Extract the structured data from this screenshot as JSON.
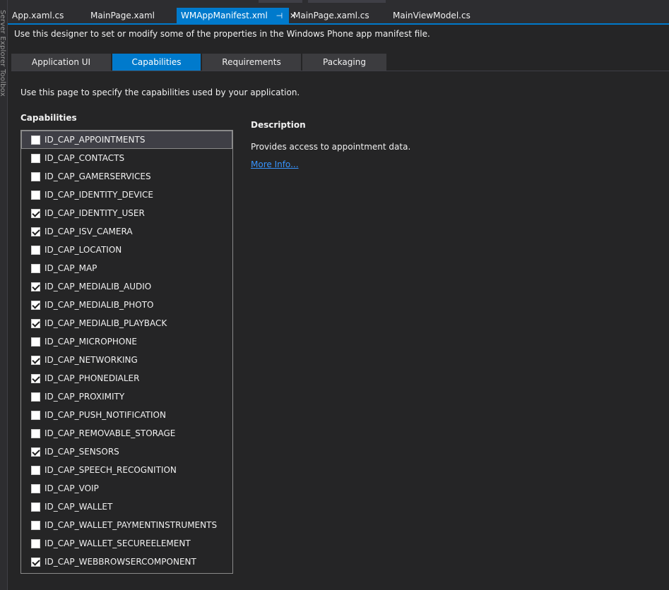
{
  "left_strip": {
    "text": "Server Explorer   Toolbox"
  },
  "doc_tabs": [
    {
      "label": "App.xaml.cs",
      "active": false
    },
    {
      "label": "MainPage.xaml",
      "active": false
    },
    {
      "label": "WMAppManifest.xml",
      "active": true,
      "pin_icon": "⊣",
      "close_icon": "✕"
    },
    {
      "label": "MainPage.xaml.cs",
      "active": false
    },
    {
      "label": "MainViewModel.cs",
      "active": false
    }
  ],
  "intro": "Use this designer to set or modify some of the properties in the Windows Phone app manifest file.",
  "sub_tabs": [
    {
      "label": "Application UI",
      "active": false
    },
    {
      "label": "Capabilities",
      "active": true
    },
    {
      "label": "Requirements",
      "active": false
    },
    {
      "label": "Packaging",
      "active": false
    }
  ],
  "page_desc": "Use this page to specify the capabilities used by your application.",
  "capabilities_heading": "Capabilities",
  "capabilities": [
    {
      "label": "ID_CAP_APPOINTMENTS",
      "checked": false,
      "selected": true
    },
    {
      "label": "ID_CAP_CONTACTS",
      "checked": false
    },
    {
      "label": "ID_CAP_GAMERSERVICES",
      "checked": false
    },
    {
      "label": "ID_CAP_IDENTITY_DEVICE",
      "checked": false
    },
    {
      "label": "ID_CAP_IDENTITY_USER",
      "checked": true
    },
    {
      "label": "ID_CAP_ISV_CAMERA",
      "checked": true
    },
    {
      "label": "ID_CAP_LOCATION",
      "checked": false
    },
    {
      "label": "ID_CAP_MAP",
      "checked": false
    },
    {
      "label": "ID_CAP_MEDIALIB_AUDIO",
      "checked": true
    },
    {
      "label": "ID_CAP_MEDIALIB_PHOTO",
      "checked": true
    },
    {
      "label": "ID_CAP_MEDIALIB_PLAYBACK",
      "checked": true
    },
    {
      "label": "ID_CAP_MICROPHONE",
      "checked": false
    },
    {
      "label": "ID_CAP_NETWORKING",
      "checked": true
    },
    {
      "label": "ID_CAP_PHONEDIALER",
      "checked": true
    },
    {
      "label": "ID_CAP_PROXIMITY",
      "checked": false
    },
    {
      "label": "ID_CAP_PUSH_NOTIFICATION",
      "checked": false
    },
    {
      "label": "ID_CAP_REMOVABLE_STORAGE",
      "checked": false
    },
    {
      "label": "ID_CAP_SENSORS",
      "checked": true
    },
    {
      "label": "ID_CAP_SPEECH_RECOGNITION",
      "checked": false
    },
    {
      "label": "ID_CAP_VOIP",
      "checked": false
    },
    {
      "label": "ID_CAP_WALLET",
      "checked": false
    },
    {
      "label": "ID_CAP_WALLET_PAYMENTINSTRUMENTS",
      "checked": false
    },
    {
      "label": "ID_CAP_WALLET_SECUREELEMENT",
      "checked": false
    },
    {
      "label": "ID_CAP_WEBBROWSERCOMPONENT",
      "checked": true
    }
  ],
  "description": {
    "heading": "Description",
    "text": "Provides access to appointment data.",
    "more_info": "More Info..."
  },
  "colors": {
    "accent": "#007acc",
    "background": "#252526",
    "chrome": "#2d2d30",
    "link": "#3794ff"
  }
}
